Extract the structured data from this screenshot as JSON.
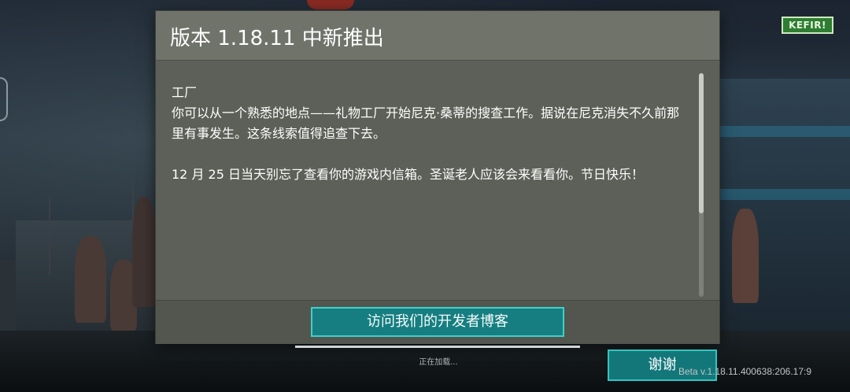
{
  "logo": {
    "text": "KEFIR!"
  },
  "dialog": {
    "title": "版本 1.18.11 中新推出",
    "paragraphs": [
      "工厂",
      "你可以从一个熟悉的地点——礼物工厂开始尼克·桑蒂的搜查工作。据说在尼克消失不久前那里有事发生。这条线索值得追查下去。",
      "12 月 25 日当天别忘了查看你的游戏内信箱。圣诞老人应该会来看看你。节日快乐！"
    ],
    "blog_button": "访问我们的开发者博客"
  },
  "loading": {
    "text": "正在加载...",
    "progress": 1.0
  },
  "thanks_button": "谢谢",
  "version": "Beta v.1.18.11.400638:206.17:9",
  "colors": {
    "dialog_bg": "#5f635a",
    "header_bg": "#6f736a",
    "button_bg": "#167e80",
    "button_border": "#3fd0cc",
    "logo_bg": "#2e7d32"
  }
}
